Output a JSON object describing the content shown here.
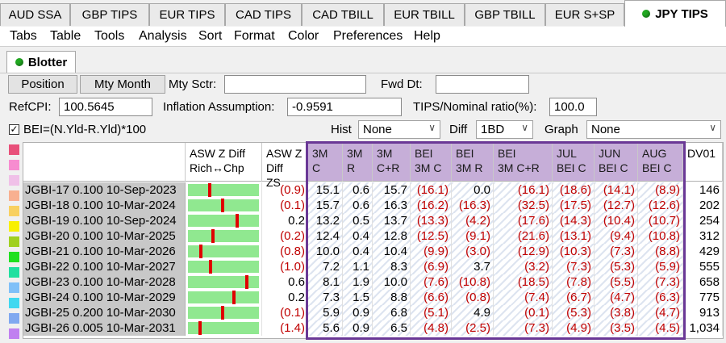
{
  "tabs": [
    {
      "label": "AUD SSA"
    },
    {
      "label": "GBP TIPS"
    },
    {
      "label": "EUR TIPS"
    },
    {
      "label": "CAD TIPS"
    },
    {
      "label": "CAD TBILL"
    },
    {
      "label": "EUR TBILL"
    },
    {
      "label": "GBP TBILL"
    },
    {
      "label": "EUR S+SP"
    },
    {
      "label": "JPY TIPS"
    }
  ],
  "active_tab": "JPY TIPS",
  "menu": [
    "Tabs",
    "Table",
    "Tools",
    "Analysis",
    "Sort",
    "Format",
    "Color",
    "Preferences",
    "Help"
  ],
  "panel": {
    "title": "Blotter"
  },
  "controls": {
    "position_btn": "Position",
    "mty_month_btn": "Mty Month",
    "mty_sctr_label": "Mty Sctr:",
    "mty_sctr_value": "",
    "fwd_dt_label": "Fwd Dt:",
    "fwd_dt_value": "",
    "refcpi_label": "RefCPI:",
    "refcpi_value": "100.5645",
    "inflation_label": "Inflation Assumption:",
    "inflation_value": "-0.9591",
    "ratio_label": "TIPS/Nominal ratio(%):",
    "ratio_value": "100.0",
    "bei_check_label": "BEI=(N.Yld-R.Yld)*100",
    "bei_checked": true,
    "hist_label": "Hist",
    "hist_value": "None",
    "diff_label": "Diff",
    "diff_value": "1BD",
    "graph_label": "Graph",
    "graph_value": "None"
  },
  "colors": {
    "swatches": [
      "#e8507a",
      "#f78cd0",
      "#f0c0e8",
      "#f8b090",
      "#f8d060",
      "#f8f000",
      "#a0d020",
      "#20e020",
      "#20e0a0",
      "#80c0f8",
      "#40d8f0",
      "#80a8f0",
      "#c080f0"
    ],
    "highlight_header": "#c6aed8",
    "highlight_border": "#6a3896",
    "negative_text": "#c00000",
    "bar_fill": "#90e890",
    "bar_marker": "#e00000"
  },
  "columns": [
    "",
    "ASW Z Diff Rich↔Chp",
    "ASW Z Diff ZS",
    "3M C",
    "3M R",
    "3M C+R",
    "BEI 3M C",
    "BEI 3M R",
    "BEI 3M C+R",
    "JUL BEI C",
    "JUN BEI C",
    "AUG BEI C",
    "DV01"
  ],
  "rows": [
    {
      "name": "JGBI-17 0.100 10-Sep-2023",
      "asw_z_diff_level": 0.3,
      "asw_zs": "(0.9)",
      "c3m": "15.1",
      "r3m": "0.6",
      "cr3m": "15.7",
      "bei_c": "(16.1)",
      "bei_r": "0.0",
      "bei_cr": "(16.1)",
      "jul": "(18.6)",
      "jun": "(14.1)",
      "aug": "(8.9)",
      "dv01": "146"
    },
    {
      "name": "JGBI-18 0.100 10-Mar-2024",
      "asw_z_diff_level": 0.49,
      "asw_zs": "(0.1)",
      "c3m": "15.7",
      "r3m": "0.6",
      "cr3m": "16.3",
      "bei_c": "(16.2)",
      "bei_r": "(16.3)",
      "bei_cr": "(32.5)",
      "jul": "(17.5)",
      "jun": "(12.7)",
      "aug": "(12.6)",
      "dv01": "202"
    },
    {
      "name": "JGBI-19 0.100 10-Sep-2024",
      "asw_z_diff_level": 0.7,
      "asw_zs": "0.2",
      "c3m": "13.2",
      "r3m": "0.5",
      "cr3m": "13.7",
      "bei_c": "(13.3)",
      "bei_r": "(4.2)",
      "bei_cr": "(17.6)",
      "jul": "(14.3)",
      "jun": "(10.4)",
      "aug": "(10.7)",
      "dv01": "254"
    },
    {
      "name": "JGBI-20 0.100 10-Mar-2025",
      "asw_z_diff_level": 0.34,
      "asw_zs": "(0.2)",
      "c3m": "12.4",
      "r3m": "0.4",
      "cr3m": "12.8",
      "bei_c": "(12.5)",
      "bei_r": "(9.1)",
      "bei_cr": "(21.6)",
      "jul": "(13.1)",
      "jun": "(9.4)",
      "aug": "(10.8)",
      "dv01": "312"
    },
    {
      "name": "JGBI-21 0.100 10-Mar-2026",
      "asw_z_diff_level": 0.17,
      "asw_zs": "(0.8)",
      "c3m": "10.0",
      "r3m": "0.4",
      "cr3m": "10.4",
      "bei_c": "(9.9)",
      "bei_r": "(3.0)",
      "bei_cr": "(12.9)",
      "jul": "(10.3)",
      "jun": "(7.3)",
      "aug": "(8.8)",
      "dv01": "429"
    },
    {
      "name": "JGBI-22 0.100 10-Mar-2027",
      "asw_z_diff_level": 0.31,
      "asw_zs": "(1.0)",
      "c3m": "7.2",
      "r3m": "1.1",
      "cr3m": "8.3",
      "bei_c": "(6.9)",
      "bei_r": "3.7",
      "bei_cr": "(3.2)",
      "jul": "(7.3)",
      "jun": "(5.3)",
      "aug": "(5.9)",
      "dv01": "555"
    },
    {
      "name": "JGBI-23 0.100 10-Mar-2028",
      "asw_z_diff_level": 0.84,
      "asw_zs": "0.6",
      "c3m": "8.1",
      "r3m": "1.9",
      "cr3m": "10.0",
      "bei_c": "(7.6)",
      "bei_r": "(10.8)",
      "bei_cr": "(18.5)",
      "jul": "(7.8)",
      "jun": "(5.5)",
      "aug": "(7.3)",
      "dv01": "658"
    },
    {
      "name": "JGBI-24 0.100 10-Mar-2029",
      "asw_z_diff_level": 0.66,
      "asw_zs": "0.2",
      "c3m": "7.3",
      "r3m": "1.5",
      "cr3m": "8.8",
      "bei_c": "(6.6)",
      "bei_r": "(0.8)",
      "bei_cr": "(7.4)",
      "jul": "(6.7)",
      "jun": "(4.7)",
      "aug": "(6.3)",
      "dv01": "775"
    },
    {
      "name": "JGBI-25 0.200 10-Mar-2030",
      "asw_z_diff_level": 0.49,
      "asw_zs": "(0.1)",
      "c3m": "5.9",
      "r3m": "0.9",
      "cr3m": "6.8",
      "bei_c": "(5.1)",
      "bei_r": "4.9",
      "bei_cr": "(0.1)",
      "jul": "(5.3)",
      "jun": "(3.8)",
      "aug": "(4.7)",
      "dv01": "913"
    },
    {
      "name": "JGBI-26 0.005 10-Mar-2031",
      "asw_z_diff_level": 0.16,
      "asw_zs": "(1.4)",
      "c3m": "5.6",
      "r3m": "0.9",
      "cr3m": "6.5",
      "bei_c": "(4.8)",
      "bei_r": "(2.5)",
      "bei_cr": "(7.3)",
      "jul": "(4.9)",
      "jun": "(3.5)",
      "aug": "(4.5)",
      "dv01": "1,034"
    }
  ]
}
